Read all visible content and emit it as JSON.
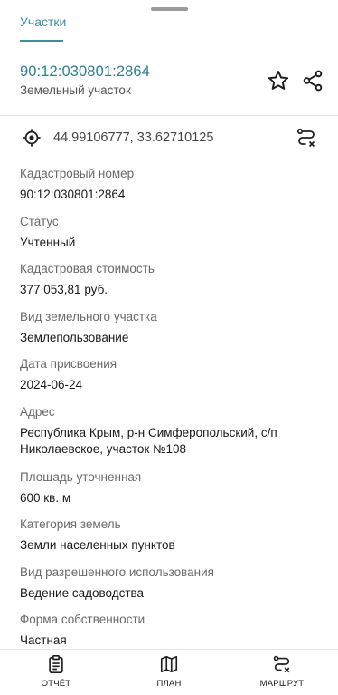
{
  "tabs": {
    "active_label": "Участки"
  },
  "header": {
    "cadastral_title": "90:12:030801:2864",
    "subtitle": "Земельный участок"
  },
  "coords": {
    "text": "44.99106777, 33.62710125"
  },
  "fields": [
    {
      "label": "Кадастровый номер",
      "value": "90:12:030801:2864"
    },
    {
      "label": "Статус",
      "value": "Учтенный"
    },
    {
      "label": "Кадастровая стоимость",
      "value": "377 053,81 руб."
    },
    {
      "label": "Вид земельного участка",
      "value": "Землепользование"
    },
    {
      "label": "Дата присвоения",
      "value": "2024-06-24"
    },
    {
      "label": "Адрес",
      "value": "Республика Крым, р-н Симферопольский, с/п Николаевское, участок №108"
    },
    {
      "label": "Площадь уточненная",
      "value": "600 кв. м"
    },
    {
      "label": "Категория земель",
      "value": "Земли населенных пунктов"
    },
    {
      "label": "Вид разрешенного использования",
      "value": "Ведение садоводства"
    },
    {
      "label": "Форма собственности",
      "value": "Частная"
    }
  ],
  "bottom_nav": {
    "report_label": "ОТЧЁТ",
    "plan_label": "ПЛАН",
    "route_label": "МАРШРУТ"
  },
  "colors": {
    "accent": "#3d8f9e",
    "title": "#2f7f8f"
  },
  "icons": [
    "star-icon",
    "share-icon",
    "target-icon",
    "route-icon",
    "clipboard-icon",
    "map-icon",
    "route-icon"
  ]
}
